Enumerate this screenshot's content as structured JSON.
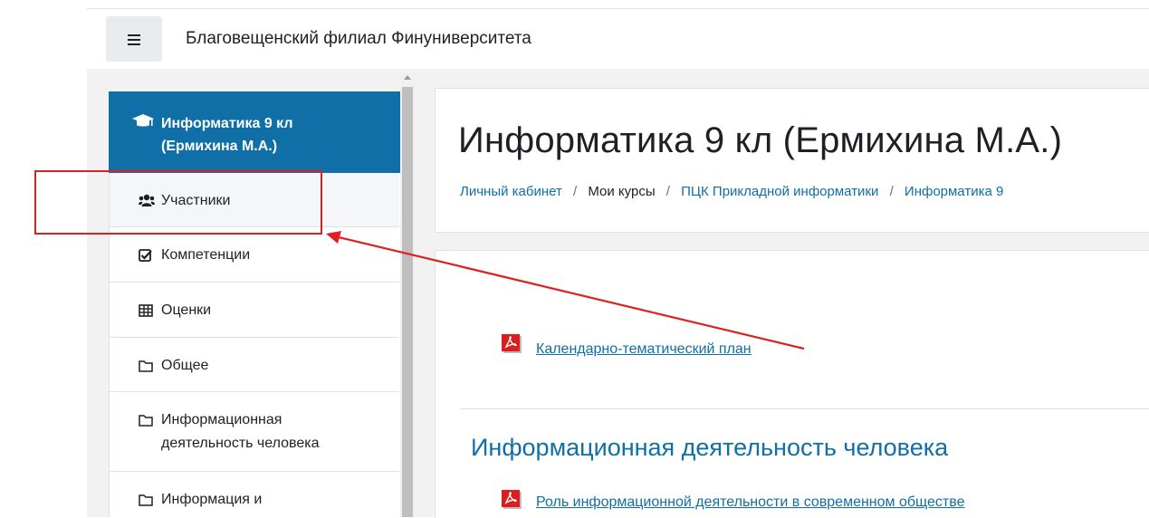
{
  "header": {
    "menu_icon": "hamburger-menu-icon",
    "site_name": "Благовещенский филиал Финуниверситета"
  },
  "drawer": {
    "course": {
      "icon": "graduation-cap-icon",
      "title_line1": "Информатика 9 кл",
      "title_line2": "(Ермихина М.А.)",
      "bg_color": "#0f6fa6"
    },
    "items": [
      {
        "icon": "users-icon",
        "label": "Участники"
      },
      {
        "icon": "check-square-icon",
        "label": "Компетенции"
      },
      {
        "icon": "table-icon",
        "label": "Оценки"
      },
      {
        "icon": "folder-icon",
        "label": "Общее"
      },
      {
        "icon": "folder-icon",
        "label_line1": "Информационная",
        "label_line2": "деятельность человека"
      },
      {
        "icon": "folder-icon",
        "label": "Информация и"
      }
    ]
  },
  "page": {
    "title": "Информатика 9 кл (Ермихина М.А.)",
    "breadcrumb": [
      {
        "label": "Личный кабинет",
        "link": true
      },
      {
        "label": "Мои курсы",
        "link": false
      },
      {
        "label": "ПЦК Прикладной информатики",
        "link": true
      },
      {
        "label": "Информатика 9",
        "link": true
      }
    ]
  },
  "content": {
    "activity_1": {
      "icon": "pdf-icon",
      "label": "Календарно-тематический план"
    },
    "section_title": "Информационная деятельность человека",
    "activity_2": {
      "icon": "pdf-icon",
      "label": "Роль информационной деятельности в современном обществе"
    }
  },
  "colors": {
    "link": "#0f6fa6",
    "annotation": "#e02020"
  }
}
